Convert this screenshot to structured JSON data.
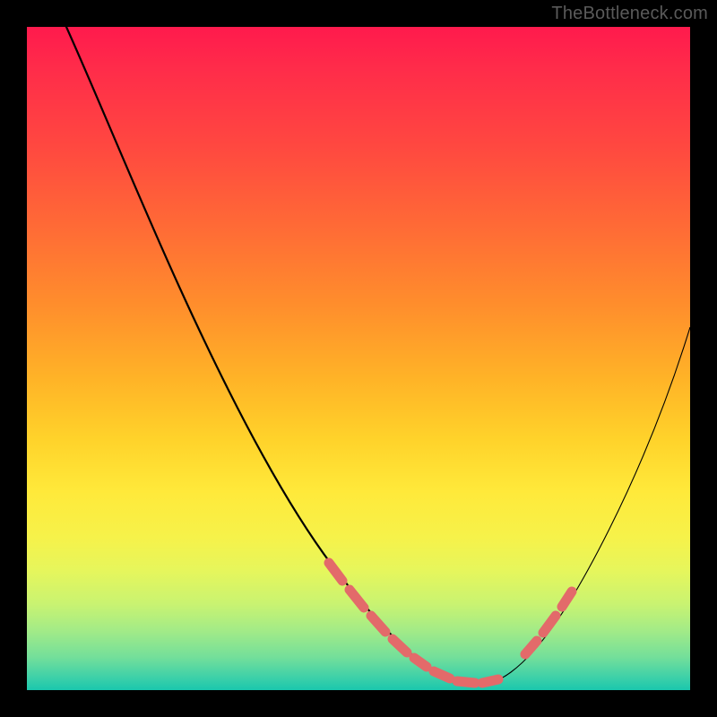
{
  "watermark": "TheBottleneck.com",
  "colors": {
    "background": "#000000",
    "gradient_top": "#ff1a4d",
    "gradient_bottom": "#1ac7ad",
    "curve": "#000000",
    "dash": "#e36a6a"
  },
  "chart_data": {
    "type": "line",
    "title": "",
    "xlabel": "",
    "ylabel": "",
    "xlim": [
      0,
      100
    ],
    "ylim": [
      0,
      100
    ],
    "series": [
      {
        "name": "bottleneck-curve",
        "x": [
          0,
          4,
          8,
          12,
          16,
          20,
          24,
          28,
          32,
          36,
          40,
          44,
          48,
          52,
          56,
          58,
          60,
          62,
          64,
          66,
          68,
          72,
          76,
          80,
          84,
          88,
          92,
          96,
          100
        ],
        "y": [
          100,
          97,
          93,
          89,
          84,
          78,
          72,
          65,
          58,
          50,
          42,
          34,
          26,
          18,
          11,
          8,
          5,
          3,
          2,
          2,
          3,
          7,
          12,
          18,
          25,
          32,
          40,
          47,
          55
        ]
      }
    ],
    "highlighted_range": {
      "name": "optimal-band",
      "x": [
        44,
        48,
        52,
        56,
        58,
        60,
        62,
        64,
        66,
        68,
        72,
        76,
        78
      ],
      "y": [
        20,
        14,
        9,
        5,
        3,
        2,
        2,
        2,
        2,
        3,
        6,
        10,
        13
      ]
    },
    "annotations": []
  }
}
